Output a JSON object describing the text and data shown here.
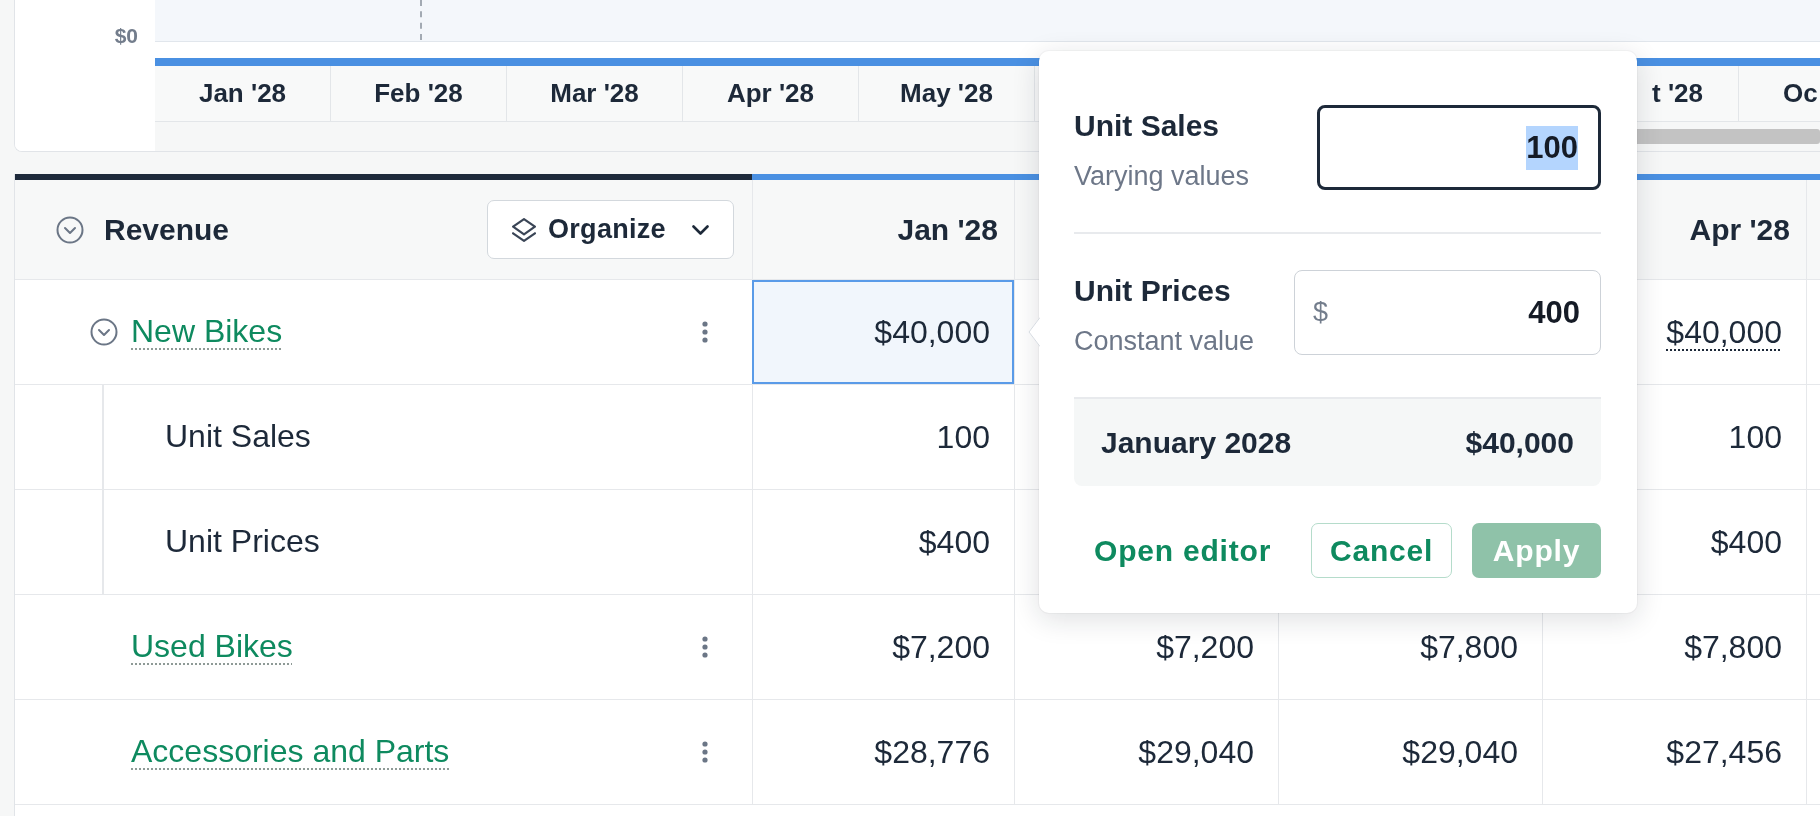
{
  "chart": {
    "axis_label": "$0",
    "months": [
      "Jan '28",
      "Feb '28",
      "Mar '28",
      "Apr '28",
      "May '28"
    ],
    "months_beside_popover": [
      "t '28",
      "Oc"
    ]
  },
  "table": {
    "title": "Revenue",
    "expanded": true,
    "organize_button": "Organize",
    "columns": [
      "Jan '28",
      null,
      null,
      "Apr '28"
    ],
    "rows": [
      {
        "label": "New Bikes",
        "expanded": true,
        "cells": [
          {
            "value": "$40,000",
            "selected": true,
            "underlined": false
          },
          null,
          null,
          {
            "value": "$40,000",
            "selected": false,
            "underlined": true
          }
        ],
        "children": [
          {
            "label": "Unit Sales",
            "cells": [
              {
                "value": "100",
                "selected": false,
                "underlined": false
              },
              null,
              null,
              {
                "value": "100",
                "selected": false,
                "underlined": false
              }
            ]
          },
          {
            "label": "Unit Prices",
            "cells": [
              {
                "value": "$400",
                "selected": false,
                "underlined": false
              },
              null,
              null,
              {
                "value": "$400",
                "selected": false,
                "underlined": false
              }
            ]
          }
        ]
      },
      {
        "label": "Used Bikes",
        "cells": [
          {
            "value": "$7,200",
            "selected": false,
            "underlined": false
          },
          {
            "value": "$7,200",
            "selected": false,
            "underlined": false
          },
          {
            "value": "$7,800",
            "selected": false,
            "underlined": false
          },
          {
            "value": "$7,800",
            "selected": false,
            "underlined": false
          }
        ]
      },
      {
        "label": "Accessories and Parts",
        "cells": [
          {
            "value": "$28,776",
            "selected": false,
            "underlined": false
          },
          {
            "value": "$29,040",
            "selected": false,
            "underlined": false
          },
          {
            "value": "$29,040",
            "selected": false,
            "underlined": false
          },
          {
            "value": "$27,456",
            "selected": false,
            "underlined": false
          }
        ]
      }
    ]
  },
  "popover": {
    "fields": [
      {
        "label": "Unit Sales",
        "hint": "Varying values",
        "value": "100",
        "focused": true,
        "text_selected": true
      },
      {
        "label": "Unit Prices",
        "hint": "Constant value",
        "prefix": "$",
        "value": "400",
        "focused": false,
        "text_selected": false
      }
    ],
    "summary": {
      "label": "January 2028",
      "value": "$40,000"
    },
    "buttons": [
      {
        "label": "Open editor",
        "kind": "link",
        "disabled": false
      },
      {
        "label": "Cancel",
        "kind": "outline",
        "disabled": false
      },
      {
        "label": "Apply",
        "kind": "primary",
        "disabled": true
      }
    ]
  }
}
